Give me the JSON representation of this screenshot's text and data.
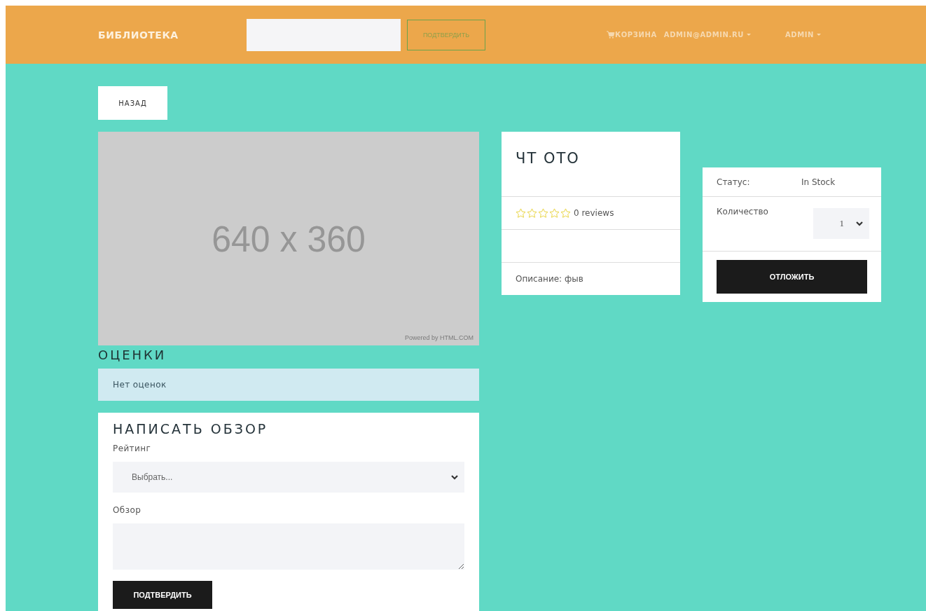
{
  "navbar": {
    "brand": "БИБЛИОТЕКА",
    "search_button": "ПОДТВЕРДИТЬ",
    "cart": "КОРЗИНА",
    "user_menu": "ADMIN@ADMIN.RU",
    "admin_menu": "ADMIN"
  },
  "back_button": "НАЗАД",
  "image": {
    "size_text": "640 x 360",
    "credit": "Powered by HTML.COM"
  },
  "product": {
    "title": "ЧТ ОТО",
    "stars": 0,
    "reviews": "0 reviews",
    "description": "Описание: фыв"
  },
  "purchase": {
    "status_label": "Статус:",
    "status_value": "In Stock",
    "quantity_label": "Количество",
    "quantity_value": "1",
    "button": "ОТЛОЖИТЬ"
  },
  "ratings": {
    "heading": "ОЦЕНКИ",
    "empty_message": "Нет оценок"
  },
  "review_form": {
    "heading": "НАПИСАТЬ ОБЗОР",
    "rating_label": "Рейтинг",
    "rating_select": "Выбрать...",
    "review_label": "Обзор",
    "submit": "ПОДТВЕРДИТЬ"
  }
}
